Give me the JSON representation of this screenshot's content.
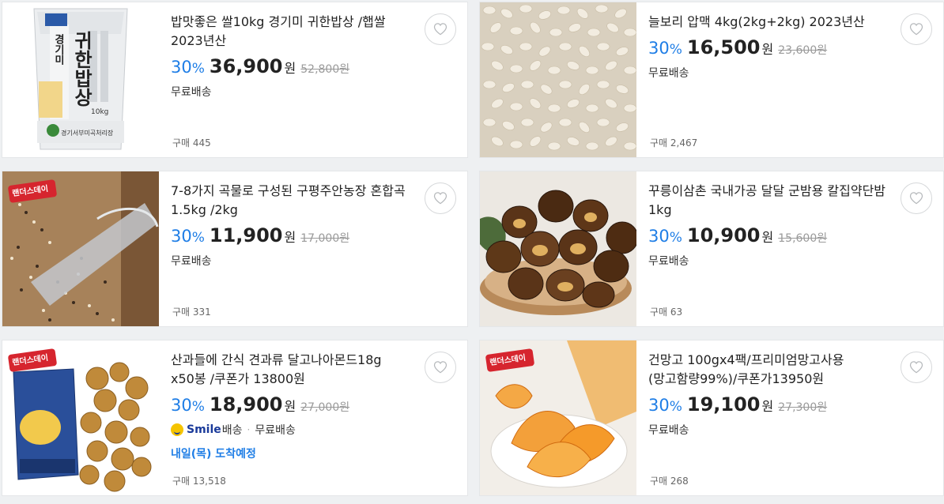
{
  "products": [
    {
      "title": "밥맛좋은 쌀10kg 경기미 귀한밥상 /햅쌀 2023년산",
      "rate": "30",
      "rate_unit": "%",
      "price": "36,900",
      "won": "원",
      "original": "52,800원",
      "shipping": "무료배송",
      "bought": "구매 445",
      "image": "rice-bag-image",
      "image_text": [
        "경기미",
        "귀한밥상",
        "10kg",
        "경기서부미곡처리장"
      ]
    },
    {
      "title": "늘보리 압맥 4kg(2kg+2kg) 2023년산",
      "rate": "30",
      "rate_unit": "%",
      "price": "16,500",
      "won": "원",
      "original": "23,600원",
      "shipping": "무료배송",
      "bought": "구매 2,467",
      "image": "pressed-barley-image"
    },
    {
      "title": "7-8가지 곡물로 구성된 구평주안농장 혼합곡 1.5kg /2kg",
      "rate": "30",
      "rate_unit": "%",
      "price": "11,900",
      "won": "원",
      "original": "17,000원",
      "shipping": "무료배송",
      "bought": "구매 331",
      "image": "mixed-grains-image",
      "badge": "랜더스데이"
    },
    {
      "title": "꾸릉이삼촌 국내가공 달달 군밤용 칼집약단밤 1kg",
      "rate": "30",
      "rate_unit": "%",
      "price": "10,900",
      "won": "원",
      "original": "15,600원",
      "shipping": "무료배송",
      "bought": "구매 63",
      "image": "chestnuts-image"
    },
    {
      "title": "산과들에 간식 견과류 달고나아몬드18g x50봉 /쿠폰가 13800원",
      "rate": "30",
      "rate_unit": "%",
      "price": "18,900",
      "won": "원",
      "original": "27,000원",
      "smile_brand": "Smile",
      "smile_suffix": "배송",
      "separator": "·",
      "shipping": "무료배송",
      "arrival": "내일(목) 도착예정",
      "bought": "구매 13,518",
      "image": "almond-snack-image",
      "badge": "랜더스데이"
    },
    {
      "title": "건망고 100gx4팩/프리미엄망고사용(망고함량99%)/쿠폰가13950원",
      "rate": "30",
      "rate_unit": "%",
      "price": "19,100",
      "won": "원",
      "original": "27,300원",
      "shipping": "무료배송",
      "bought": "구매 268",
      "image": "dried-mango-image",
      "badge": "랜더스데이"
    }
  ],
  "colors": {
    "discount": "#1f7ee6",
    "badge_red": "#d6252e",
    "smile_yellow": "#f5c400"
  }
}
